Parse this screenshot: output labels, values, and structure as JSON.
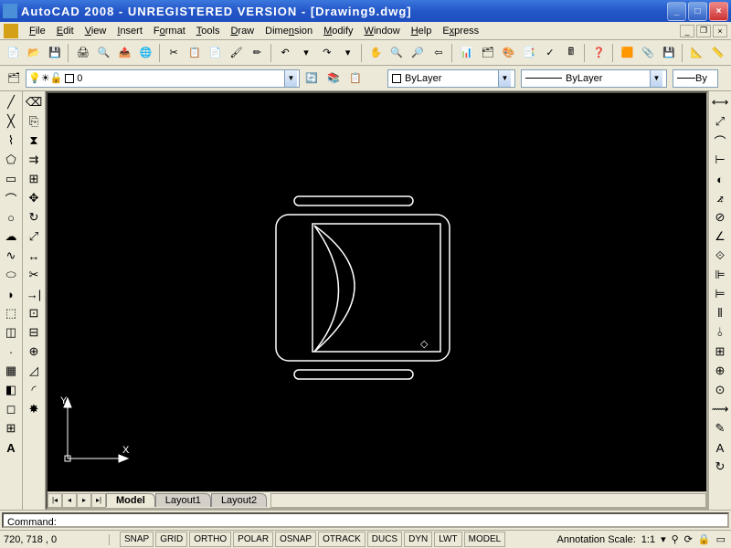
{
  "title": "AutoCAD 2008 - UNREGISTERED VERSION - [Drawing9.dwg]",
  "menu": {
    "file": "File",
    "edit": "Edit",
    "view": "View",
    "insert": "Insert",
    "format": "Format",
    "tools": "Tools",
    "draw": "Draw",
    "dimension": "Dimension",
    "modify": "Modify",
    "window": "Window",
    "help": "Help",
    "express": "Express"
  },
  "layer": {
    "current": "0",
    "color_swatch": "#ffffff"
  },
  "props": {
    "color_label": "ByLayer",
    "linetype_label": "ByLayer",
    "lineweight_label": "By"
  },
  "tabs": {
    "model": "Model",
    "layout1": "Layout1",
    "layout2": "Layout2"
  },
  "command": {
    "prompt": "Command:"
  },
  "status": {
    "coords": "720, 718 , 0",
    "snap": "SNAP",
    "grid": "GRID",
    "ortho": "ORTHO",
    "polar": "POLAR",
    "osnap": "OSNAP",
    "otrack": "OTRACK",
    "ducs": "DUCS",
    "dyn": "DYN",
    "lwt": "LWT",
    "model": "MODEL",
    "annoscale_label": "Annotation Scale:",
    "annoscale_value": "1:1"
  },
  "ucs": {
    "x": "X",
    "y": "Y"
  }
}
